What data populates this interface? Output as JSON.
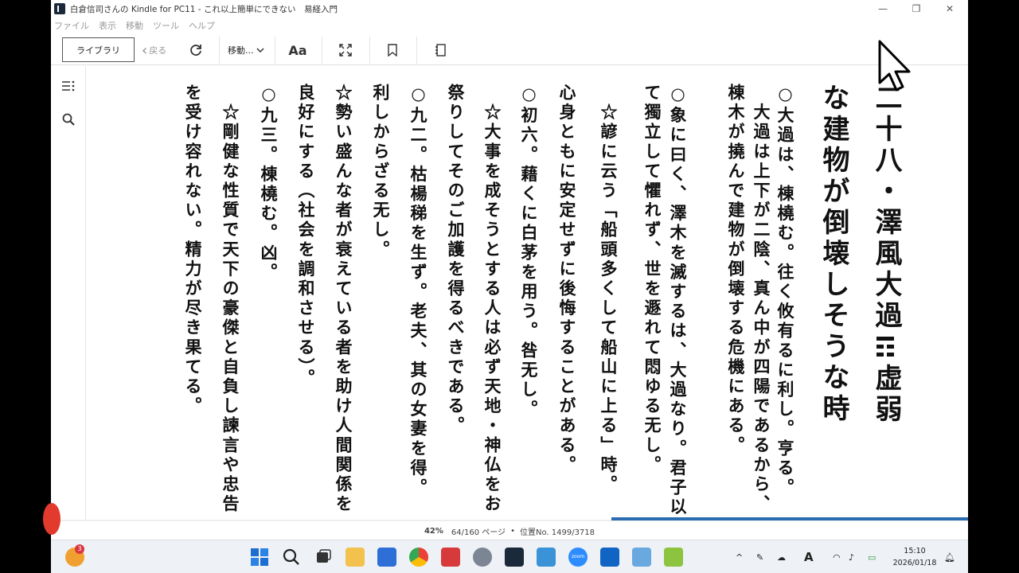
{
  "window": {
    "title": "白倉信司さんの Kindle for PC11 - これ以上簡単にできない　易経入門",
    "controls": {
      "minimize": "—",
      "maximize": "❐",
      "close": "✕"
    }
  },
  "menu": [
    "ファイル",
    "表示",
    "移動",
    "ツール",
    "ヘルプ"
  ],
  "toolbar": {
    "library_label": "ライブラリ",
    "back_label": "戻る",
    "goto_label": "移動...",
    "font_label": "Aa"
  },
  "page": {
    "heading_line1": "二十八・澤風大過",
    "heading_tail": "虚弱",
    "heading_line2": "な建物が倒壊しそうな時",
    "lines": [
      "○大過は、棟橈む。往く攸有るに利し。亨る。",
      "　大過は上下が二陰、真ん中が四陽であるから、",
      "棟木が撓んで建物が倒壊する危機にある。",
      "○象に曰く、澤木を滅するは、大過なり。君子以",
      "て獨立して懼れず、世を遯れて悶ゆる无し。",
      "　☆諺に云う「船頭多くして船山に上る」時。",
      "心身ともに安定せずに後悔することがある。",
      "○初六。藉くに白茅を用う。咎无し。",
      "　☆大事を成そうとする人は必ず天地・神仏をお",
      "祭りしてそのご加護を得るべきである。",
      "○九二。枯楊稊を生ず。老夫、其の女妻を得。",
      "利しからざる无し。",
      "☆勢い盛んな者が衰えている者を助け人間関係を",
      "良好にする（社会を調和させる）。",
      "○九三。棟橈む。凶。",
      "　☆剛健な性質で天下の豪傑と自負し諫言や忠告",
      "を受け容れない。精力が尽き果てる。"
    ]
  },
  "status": {
    "percent": "42%",
    "pages": "64/160 ページ",
    "separator": "•",
    "location": "位置No. 1499/3718"
  },
  "progress": {
    "fraction": 0.42
  },
  "taskbar": {
    "badge": "3",
    "time": "15:10",
    "date": "2026/01/18",
    "zoom_label": "zoom"
  }
}
